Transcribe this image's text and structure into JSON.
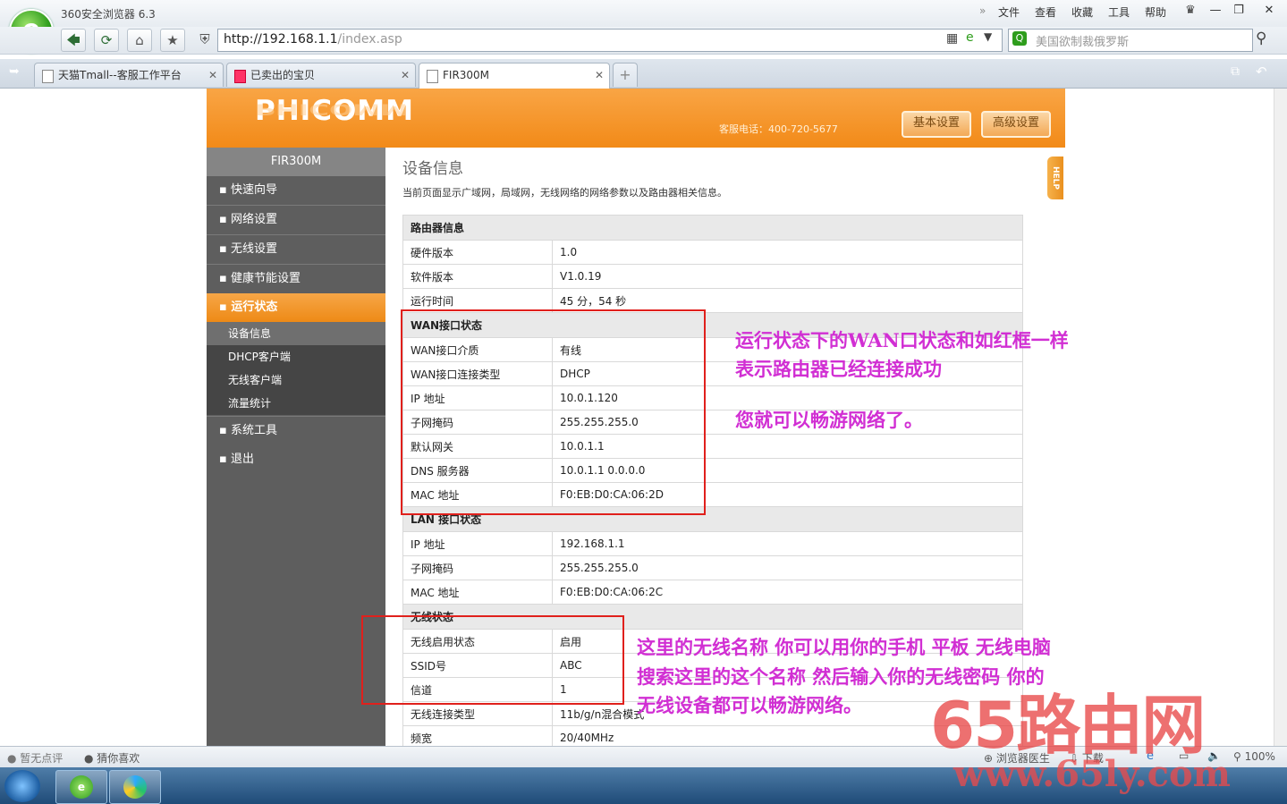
{
  "browser": {
    "app_title": "360安全浏览器 6.3",
    "menu": [
      "文件",
      "查看",
      "收藏",
      "工具",
      "帮助"
    ],
    "address_host": "http://192.168.1.1",
    "address_path": "/index.asp",
    "search_text": "美国欲制裁俄罗斯",
    "tabs": [
      {
        "label": "天猫Tmall--客服工作平台",
        "active": false
      },
      {
        "label": "已卖出的宝贝",
        "active": false
      },
      {
        "label": "FIR300M",
        "active": true
      }
    ],
    "status_left": "暂无点评",
    "status_guess": "猜你喜欢",
    "status_doctor": "浏览器医生",
    "status_download": "下载",
    "zoom": "100%"
  },
  "router": {
    "brand": "PHICOMM",
    "hotline": "客服电话：400-720-5677",
    "btn_basic": "基本设置",
    "btn_advanced": "高级设置",
    "model": "FIR300M",
    "help": "HELP",
    "menu": [
      {
        "label": "快速向导"
      },
      {
        "label": "网络设置"
      },
      {
        "label": "无线设置"
      },
      {
        "label": "健康节能设置"
      },
      {
        "label": "运行状态"
      },
      {
        "label": "系统工具"
      },
      {
        "label": "退出"
      }
    ],
    "submenu": [
      "设备信息",
      "DHCP客户端",
      "无线客户端",
      "流量统计"
    ],
    "page_title": "设备信息",
    "page_desc": "当前页面显示广域网，局域网，无线网络的网络参数以及路由器相关信息。",
    "sections": {
      "router_info": {
        "title": "路由器信息",
        "rows": [
          [
            "硬件版本",
            "1.0"
          ],
          [
            "软件版本",
            "V1.0.19"
          ],
          [
            "运行时间",
            "45 分，54 秒"
          ]
        ]
      },
      "wan": {
        "title": "WAN接口状态",
        "rows": [
          [
            "WAN接口介质",
            "有线"
          ],
          [
            "WAN接口连接类型",
            "DHCP"
          ],
          [
            "IP 地址",
            "10.0.1.120"
          ],
          [
            "子网掩码",
            "255.255.255.0"
          ],
          [
            "默认网关",
            "10.0.1.1"
          ],
          [
            "DNS 服务器",
            "10.0.1.1 0.0.0.0"
          ],
          [
            "MAC 地址",
            "F0:EB:D0:CA:06:2D"
          ]
        ]
      },
      "lan": {
        "title": "LAN 接口状态",
        "rows": [
          [
            "IP 地址",
            "192.168.1.1"
          ],
          [
            "子网掩码",
            "255.255.255.0"
          ],
          [
            "MAC 地址",
            "F0:EB:D0:CA:06:2C"
          ]
        ]
      },
      "wireless": {
        "title": "无线状态",
        "rows": [
          [
            "无线启用状态",
            "启用"
          ],
          [
            "SSID号",
            "ABC"
          ],
          [
            "信道",
            "1"
          ],
          [
            "无线连接类型",
            "11b/g/n混合模式"
          ],
          [
            "频宽",
            "20/40MHz"
          ]
        ]
      }
    }
  },
  "annotations": {
    "note1_line1": "运行状态下的WAN口状态和如红框一样",
    "note1_line2": "表示路由器已经连接成功",
    "note1_line3": "您就可以畅游网络了。",
    "note2_line1": "这里的无线名称 你可以用你的手机 平板 无线电脑",
    "note2_line2": "搜索这里的这个名称 然后输入你的无线密码  你的",
    "note2_line3": "无线设备都可以畅游网络。",
    "watermark_big": "65路由网",
    "watermark_url": "www.65ly.com"
  }
}
